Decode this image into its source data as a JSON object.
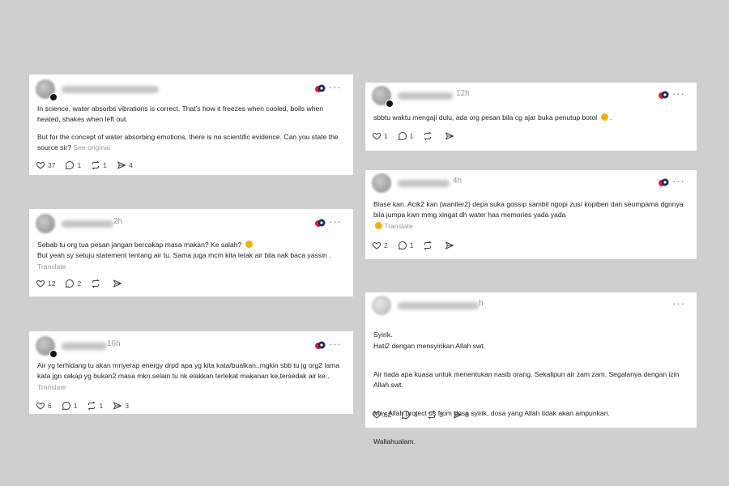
{
  "posts": [
    {
      "time": "",
      "paragraphs": [
        "In science, water absorbs vibrations is correct. That's how it freezes when cooled, boils when heated, shakes when left out.",
        "But for the concept of water absorbing emotions, there is no scientific evidence. Can you state the source sir?"
      ],
      "link_label": "See original",
      "likes": "37",
      "replies": "1",
      "reposts": "1",
      "shares": "4"
    },
    {
      "time": "2h",
      "paragraphs": [
        "Sebab tu org tua pesan jangan bercakap masa makan? Ke salah?",
        "But yeah sy setuju statement tentang air tu. Sama juga mcm kita letak air bila nak baca yassin ."
      ],
      "link_label": "Translate",
      "likes": "12",
      "replies": "2",
      "reposts": "",
      "shares": ""
    },
    {
      "time": "16h",
      "paragraphs": [
        "Air yg terhidang tu akan mnyerap energy drpd apa yg kita kata/bualkan..mgkin sbb tu jg org2 lama kata jgn cakap yg bukan2 masa mkn.selain tu nk elakkan terlekat makanan ke,tersedak air ke.."
      ],
      "link_label": "Translate",
      "likes": "6",
      "replies": "1",
      "reposts": "1",
      "shares": "3"
    },
    {
      "time": "12h",
      "paragraphs": [
        "sbbtu waktu mengaji dulu, ada org pesan bila cg ajar buka penutup botol"
      ],
      "link_label": "",
      "likes": "1",
      "replies": "1",
      "reposts": "",
      "shares": ""
    },
    {
      "time": "4h",
      "paragraphs": [
        "Biase kan. Acik2 kan (waniter2) depa suka gossip sambil ngopi zus/ kopiben dan seumpama dgnnya bila jumpa kwn mmg xingat dh water has memories yada yada"
      ],
      "link_label": "Translate",
      "likes": "2",
      "replies": "1",
      "reposts": "",
      "shares": ""
    },
    {
      "time": "h",
      "paragraphs": [
        "Syirik.\nHati2 dengan mensyirikan Allah swt.",
        "Air tiada apa kuasa untuk menentukan nasib orang. Sekalipun air zam zam. Segalanya dengan izin Allah swt.",
        "May Allah protect us from dosa syirik, dosa yang Allah tidak akan ampunkan.",
        "Wallahualam."
      ],
      "link_label": "",
      "likes": "62",
      "replies": "4",
      "reposts": "3",
      "shares": "8"
    }
  ],
  "colors": {
    "background": "#cfcfcf",
    "card": "#ffffff",
    "muted": "#9a9a9a",
    "flair_red": "#e0203a",
    "flair_dark": "#1d2a5a"
  },
  "icons": [
    "heart-icon",
    "reply-icon",
    "repost-icon",
    "share-icon",
    "more-icon",
    "avatar"
  ]
}
